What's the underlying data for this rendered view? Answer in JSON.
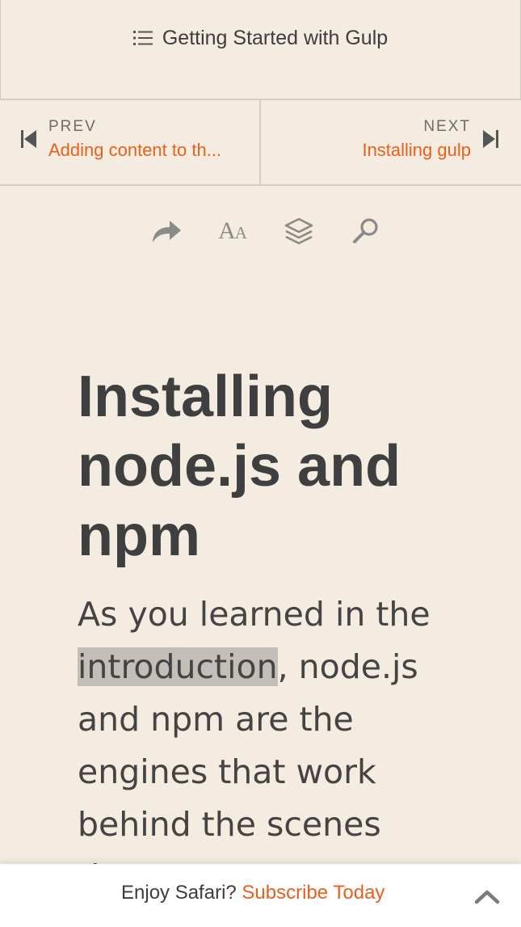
{
  "header": {
    "toc_label": "Getting Started with Gulp",
    "toc_icon": "list-icon"
  },
  "nav": {
    "prev_label": "PREV",
    "prev_title": "Adding content to th...",
    "next_label": "NEXT",
    "next_title": "Installing gulp"
  },
  "toolbar": {
    "icons": [
      "share-icon",
      "font-size-icon",
      "layers-icon",
      "search-icon"
    ],
    "font_big": "A",
    "font_small": "A"
  },
  "article": {
    "title": "Installing node.js and npm",
    "para_start": "As you learned in the ",
    "para_link": "introduction",
    "para_rest": ", node.js and npm are the engines that work behind the scenes that"
  },
  "banner": {
    "text": "Enjoy Safari?",
    "link": "Subscribe Today"
  },
  "colors": {
    "background": "#f4ece0",
    "accent": "#e8601c",
    "text": "#3d3d3d",
    "highlight": "#c3bfb8"
  }
}
